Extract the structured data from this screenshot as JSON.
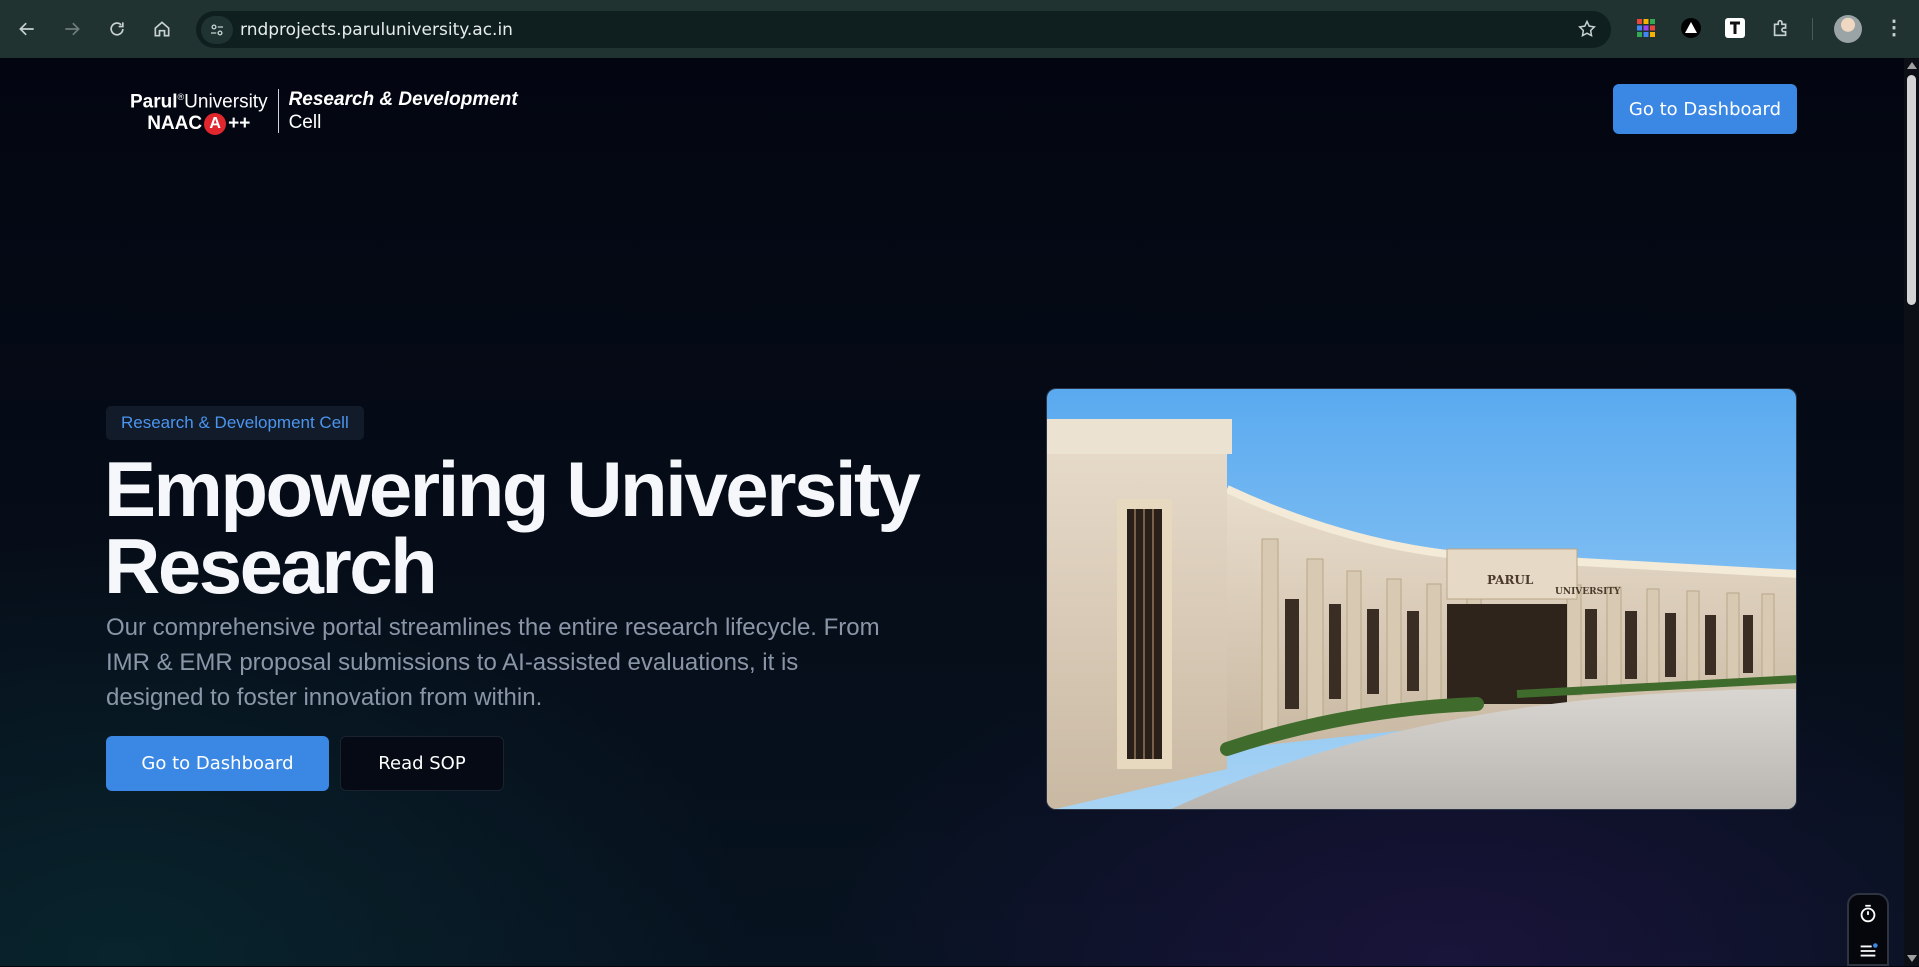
{
  "browser": {
    "url": "rndprojects.paruluniversity.ac.in"
  },
  "header": {
    "logo": {
      "brand": "Parul",
      "reg_mark": "®",
      "university": "University",
      "naac": "NAAC",
      "grade_letter": "A",
      "grade_plus": "++",
      "cell_title": "Research & Development",
      "cell_subtitle": "Cell"
    },
    "dashboard_button": "Go to Dashboard"
  },
  "hero": {
    "tag": "Research & Development Cell",
    "title_line1": "Empowering University",
    "title_line2": "Research",
    "description": "Our comprehensive portal streamlines the entire research lifecycle. From IMR & EMR proposal submissions to AI-assisted evaluations, it is designed to foster innovation from within.",
    "primary_button": "Go to Dashboard",
    "secondary_button": "Read SOP",
    "image_sign_left": "PARUL",
    "image_sign_right": "UNIVERSITY"
  },
  "colors": {
    "accent": "#3b87e4",
    "tag_text": "#4b95ef",
    "background": "#03060f",
    "description": "#8a96a8"
  }
}
